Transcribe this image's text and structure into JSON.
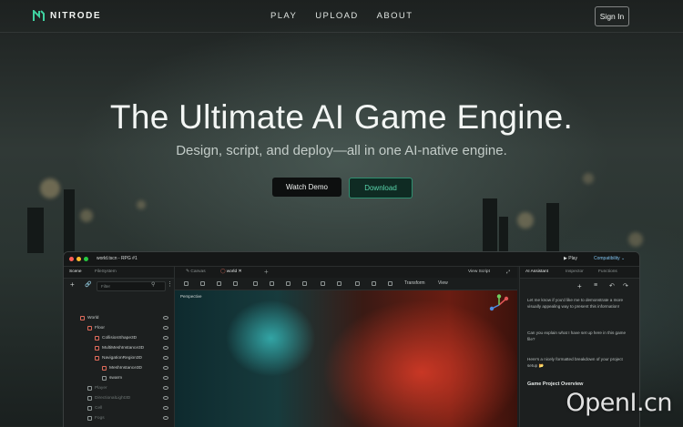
{
  "nav": {
    "brand": "NITRODE",
    "links": [
      "PLAY",
      "UPLOAD",
      "ABOUT"
    ],
    "signin": "Sign In"
  },
  "hero": {
    "title": "The Ultimate AI Game Engine.",
    "subtitle": "Design, script, and deploy—all in one AI-native engine.",
    "watch_demo": "Watch Demo",
    "download": "Download"
  },
  "editor": {
    "window_title": "world.tscn - RPG #1",
    "play": "Play",
    "compatibility": "Compatibility",
    "left_tabs": [
      "Scene",
      "FileSystem"
    ],
    "filter_placeholder": "Filter",
    "tree": [
      {
        "label": "World",
        "icon_color": "#e06b5b"
      },
      {
        "label": "Floor",
        "icon_color": "#e06b5b"
      },
      {
        "label": "CollisionShape3D",
        "icon_color": "#e06b5b"
      },
      {
        "label": "MultiMeshInstance3D",
        "icon_color": "#e06b5b"
      },
      {
        "label": "NavigationRegion3D",
        "icon_color": "#e06b5b"
      },
      {
        "label": "MeshInstance3D",
        "icon_color": "#e06b5b"
      },
      {
        "label": "swarm",
        "icon_color": "#8f9796"
      },
      {
        "label": "Player",
        "icon_color": "#8f9796"
      },
      {
        "label": "DirectionalLight3D",
        "icon_color": "#8f9796"
      },
      {
        "label": "Cell",
        "icon_color": "#8f9796"
      },
      {
        "label": "Fogs",
        "icon_color": "#8f9796"
      }
    ],
    "center_tabs": [
      "Canvas",
      "world"
    ],
    "view_script": "View Script",
    "toolbar_labels": [
      "Transform",
      "View"
    ],
    "viewport_label": "Perspective",
    "right_tabs": [
      "AI Assistant",
      "Inspector",
      "Functions"
    ],
    "chat": [
      "Let me know if you'd like me to demonstrate a more visually appealing way to present this information!",
      "Can you explain what I have set up here in this game file?",
      "Here's a nicely formatted breakdown of your project setup 📂"
    ],
    "chat_heading": "Game Project Overview"
  },
  "watermark": "OpenI.cn",
  "colors": {
    "accent": "#59d4ab",
    "link_blue": "#7fc2ee"
  }
}
